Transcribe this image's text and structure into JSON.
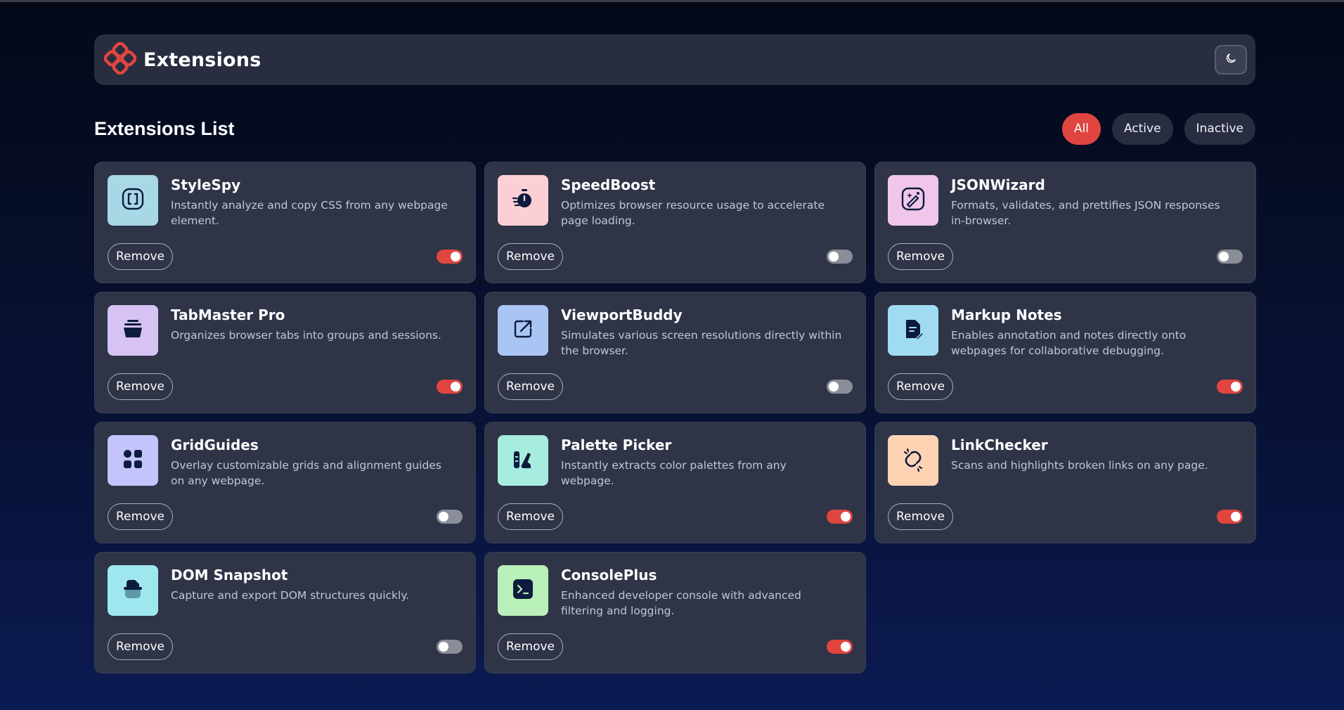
{
  "app": {
    "title": "Extensions",
    "list_title": "Extensions List",
    "accent": "#e0453f"
  },
  "filters": [
    {
      "label": "All",
      "selected": true
    },
    {
      "label": "Active",
      "selected": false
    },
    {
      "label": "Inactive",
      "selected": false
    }
  ],
  "extensions": [
    {
      "name": "StyleSpy",
      "description": "Instantly analyze and copy CSS from any webpage element.",
      "active": true,
      "icon": "css-brackets-icon",
      "icon_bg": "#a8d8e6",
      "remove_label": "Remove"
    },
    {
      "name": "SpeedBoost",
      "description": "Optimizes browser resource usage to accelerate page loading.",
      "active": false,
      "icon": "stopwatch-icon",
      "icon_bg": "#fbcfd4",
      "remove_label": "Remove"
    },
    {
      "name": "JSONWizard",
      "description": "Formats, validates, and prettifies JSON responses in-browser.",
      "active": false,
      "icon": "magic-wand-icon",
      "icon_bg": "#f0c6ea",
      "remove_label": "Remove"
    },
    {
      "name": "TabMaster Pro",
      "description": "Organizes browser tabs into groups and sessions.",
      "active": true,
      "icon": "stacked-tabs-icon",
      "icon_bg": "#d7c3f3",
      "remove_label": "Remove"
    },
    {
      "name": "ViewportBuddy",
      "description": "Simulates various screen resolutions directly within the browser.",
      "active": false,
      "icon": "resize-window-icon",
      "icon_bg": "#aac5f4",
      "remove_label": "Remove"
    },
    {
      "name": "Markup Notes",
      "description": "Enables annotation and notes directly onto webpages for collaborative debugging.",
      "active": true,
      "icon": "note-pen-icon",
      "icon_bg": "#9fdcf1",
      "remove_label": "Remove"
    },
    {
      "name": "GridGuides",
      "description": "Overlay customizable grids and alignment guides on any webpage.",
      "active": false,
      "icon": "grid-layout-icon",
      "icon_bg": "#c4c3fb",
      "remove_label": "Remove"
    },
    {
      "name": "Palette Picker",
      "description": "Instantly extracts color palettes from any webpage.",
      "active": true,
      "icon": "palette-icon",
      "icon_bg": "#a6ecdf",
      "remove_label": "Remove"
    },
    {
      "name": "LinkChecker",
      "description": "Scans and highlights broken links on any page.",
      "active": true,
      "icon": "broken-link-icon",
      "icon_bg": "#fdd3b4",
      "remove_label": "Remove"
    },
    {
      "name": "DOM Snapshot",
      "description": "Capture and export DOM structures quickly.",
      "active": false,
      "icon": "snapshot-icon",
      "icon_bg": "#9fe7ee",
      "remove_label": "Remove"
    },
    {
      "name": "ConsolePlus",
      "description": "Enhanced developer console with advanced filtering and logging.",
      "active": true,
      "icon": "terminal-icon",
      "icon_bg": "#b9f0b9",
      "remove_label": "Remove"
    }
  ]
}
